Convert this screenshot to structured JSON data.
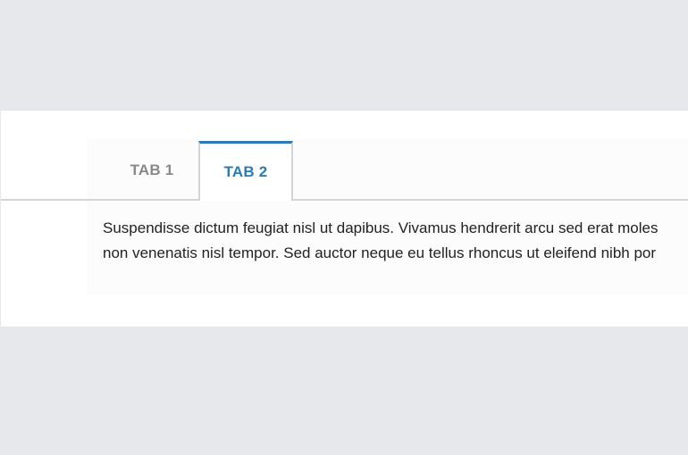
{
  "tabs": {
    "items": [
      {
        "label": "TAB 1",
        "selected": false
      },
      {
        "label": "TAB 2",
        "selected": true
      }
    ],
    "active_color": "#2a7ab8",
    "inactive_color": "#8a8a8a"
  },
  "content": {
    "line1": "Suspendisse dictum feugiat nisl ut dapibus. Vivamus hendrerit arcu sed erat moles",
    "line2": "non venenatis nisl tempor. Sed auctor neque eu tellus rhoncus ut eleifend nibh por"
  }
}
